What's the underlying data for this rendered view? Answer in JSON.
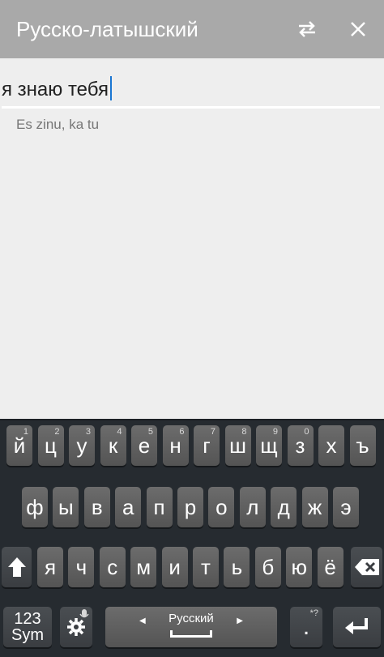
{
  "app": {
    "title": "Русско-латышский"
  },
  "input": {
    "text": "я знаю тебя"
  },
  "result": {
    "text": "Es zinu, ka tu"
  },
  "keyboard": {
    "row1": [
      {
        "label": "й",
        "hint": "1"
      },
      {
        "label": "ц",
        "hint": "2"
      },
      {
        "label": "у",
        "hint": "3"
      },
      {
        "label": "к",
        "hint": "4"
      },
      {
        "label": "е",
        "hint": "5"
      },
      {
        "label": "н",
        "hint": "6"
      },
      {
        "label": "г",
        "hint": "7"
      },
      {
        "label": "ш",
        "hint": "8"
      },
      {
        "label": "щ",
        "hint": "9"
      },
      {
        "label": "з",
        "hint": "0"
      },
      {
        "label": "х",
        "hint": ""
      },
      {
        "label": "ъ",
        "hint": ""
      }
    ],
    "row2": [
      "ф",
      "ы",
      "в",
      "а",
      "п",
      "р",
      "о",
      "л",
      "д",
      "ж",
      "э"
    ],
    "row3": [
      "я",
      "ч",
      "с",
      "м",
      "и",
      "т",
      "ь",
      "б",
      "ю",
      "ё"
    ],
    "sym_label_line1": "123",
    "sym_label_line2": "Sym",
    "space_label": "Русский",
    "period_label": ".",
    "period_hint": "*?"
  },
  "colors": {
    "appbar": "#a9a9a9",
    "background": "#eeeeee",
    "keyboard": "#262b30",
    "caret": "#1a76d2"
  },
  "icons": [
    "swap-arrows-icon",
    "close-icon",
    "shift-icon",
    "backspace-icon",
    "settings-gear-icon",
    "microphone-hint-icon",
    "enter-icon"
  ]
}
